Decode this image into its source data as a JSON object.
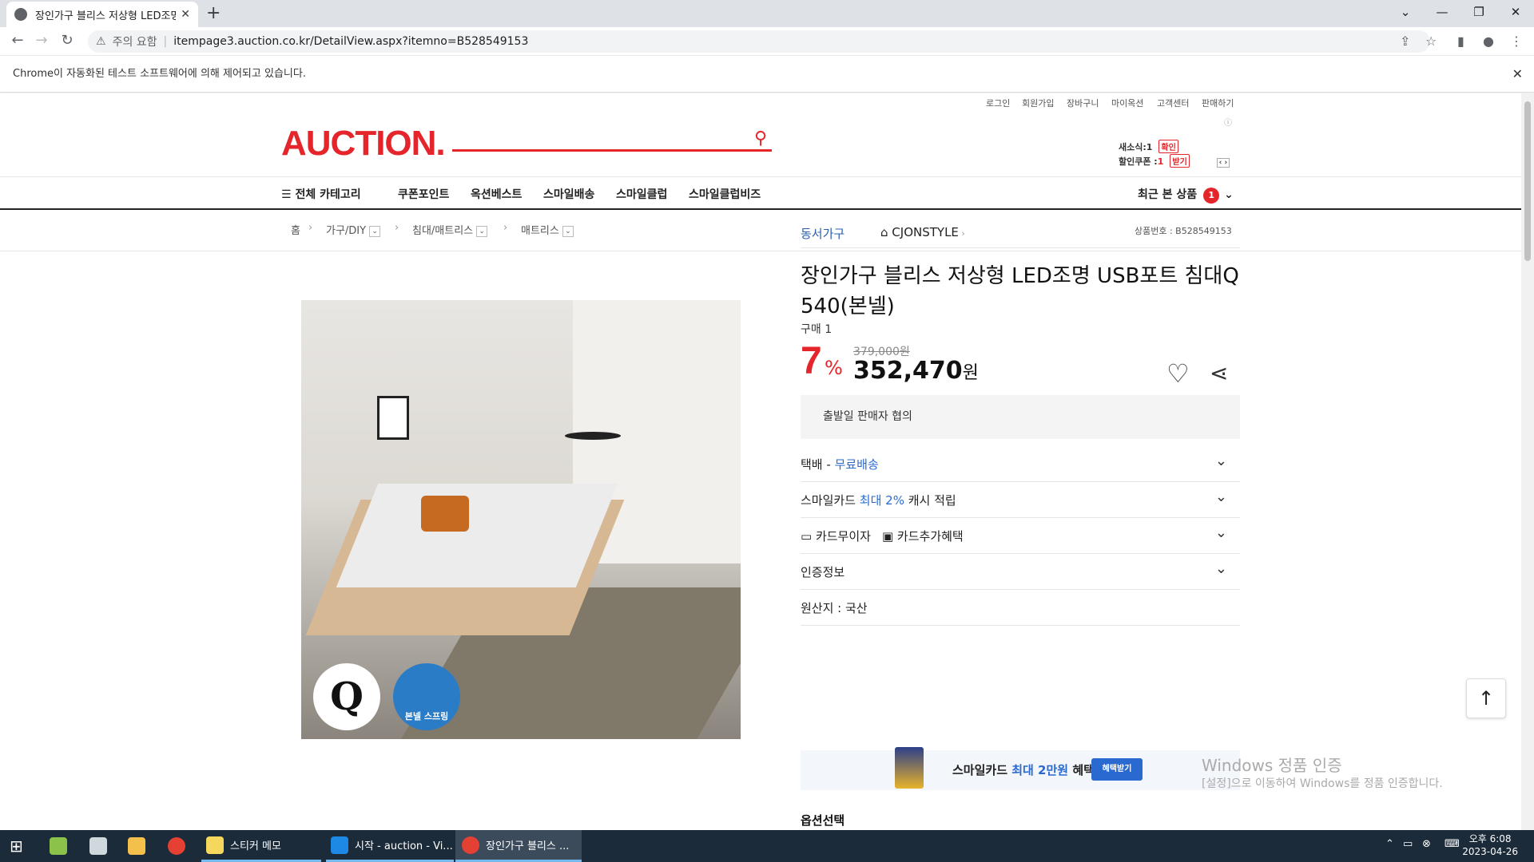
{
  "browser": {
    "tab_title": "장인가구 블리스 저상형 LED조명",
    "tab_close": "✕",
    "new_tab": "+",
    "security_label": "주의 요함",
    "url": "itempage3.auction.co.kr/DetailView.aspx?itemno=B528549153",
    "infobar_text": "Chrome이 자동화된 테스트 소프트웨어에 의해 제어되고 있습니다.",
    "infobar_close": "✕"
  },
  "header": {
    "util_links": [
      "로그인",
      "회원가입",
      "장바구니",
      "마이옥션",
      "고객센터",
      "판매하기"
    ],
    "logo": "AUCTION.",
    "news_label": "새소식:",
    "news_count": "1",
    "news_button": "확인",
    "coupon_label": "할인쿠폰 :",
    "coupon_count": "1",
    "coupon_button": "받기"
  },
  "gnb": {
    "all_category": "전체 카테고리",
    "items": [
      "쿠폰포인트",
      "옥션베스트",
      "스마일배송",
      "스마일클럽",
      "스마일클럽비즈"
    ],
    "recent": "최근 본 상품",
    "recent_count": "1"
  },
  "breadcrumb": {
    "home": "홈",
    "levels": [
      "가구/DIY",
      "침대/매트리스",
      "매트리스"
    ],
    "product_no": "상품번호 : B528549153"
  },
  "product": {
    "image_badge_q": "Q",
    "image_badge_spring": "본넬 스프링",
    "seller": "동서가구",
    "store": "CJONSTYLE",
    "title": "장인가구 블리스 저상형 LED조명 USB포트 침대Q 540(본넬)",
    "buy_count": "구매 1",
    "discount": "7",
    "discount_unit": "%",
    "original_price": "379,000원",
    "sale_price": "352,470",
    "sale_unit": "원",
    "ship_date": "출발일 판매자 협의",
    "delivery_label": "택배 - ",
    "delivery_value": "무료배송",
    "smilecard_a": "스마일카드 ",
    "smilecard_b": "최대 2%",
    "smilecard_c": " 캐시 적립",
    "card_interest": "카드무이자",
    "card_benefit": "카드추가혜택",
    "certification": "인증정보",
    "origin": "원산지 : 국산",
    "banner_a": "스마일카드 ",
    "banner_b": "최대 2만원",
    "banner_c": " 혜택!",
    "banner_button": "혜택받기",
    "option_select": "옵션선택"
  },
  "watermark": {
    "line1": "Windows 정품 인증",
    "line2": "[설정]으로 이동하여 Windows를 정품 인증합니다."
  },
  "taskbar": {
    "apps": [
      "스티커 메모",
      "시작 - auction - Vi...",
      "장인가구 블리스 ..."
    ],
    "time": "오후 6:08",
    "date": "2023-04-26"
  },
  "colors": {
    "brand": "#e4262c",
    "link": "#2a6ad0",
    "taskbar": "#1c2b3a"
  }
}
